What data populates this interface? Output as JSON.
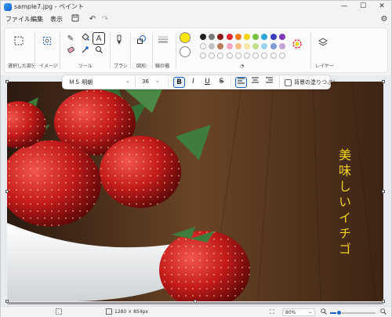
{
  "window": {
    "title": "sample7.jpg - ペイント",
    "minimize_glyph": "—",
    "maximize_glyph": "☐",
    "close_glyph": "✕"
  },
  "menu": {
    "file": "ファイル",
    "edit": "編集",
    "view": "表示"
  },
  "ribbon": {
    "groups": {
      "selection": "選択した部分",
      "image": "イメージ",
      "tools": "ツール",
      "brush": "ブラシ",
      "shapes": "図形",
      "size": "線の幅",
      "layers": "レイヤー"
    },
    "primary_color": "#ffe600",
    "secondary_color": "#ffffff",
    "palette_row1": [
      "#1f1f1f",
      "#7a7a7a",
      "#8b1a1a",
      "#e3262e",
      "#f07a1b",
      "#f6d40a",
      "#7cc242",
      "#2fa6d9",
      "#3b3fbf",
      "#7c3ab7"
    ],
    "palette_row2": [
      "#ffffff",
      "#c3c3c3",
      "#b97a57",
      "#f4a5c2",
      "#f6c08a",
      "#f3e6a6",
      "#c2dd8a",
      "#9bd3ec",
      "#7f9bd6",
      "#c3a5d9"
    ]
  },
  "text_toolbar": {
    "font": "ＭＳ 明朝",
    "size": "36",
    "bold": "B",
    "italic": "I",
    "underline": "U",
    "strike": "S",
    "fill_background_label": "背景の塗りつぶし"
  },
  "canvas": {
    "overlay_text": "美味しいイチゴ",
    "overlay_color": "#f1d21a"
  },
  "status": {
    "dimensions": "1280 × 854px",
    "zoom": "80%",
    "zoom_fraction": 0.2
  }
}
